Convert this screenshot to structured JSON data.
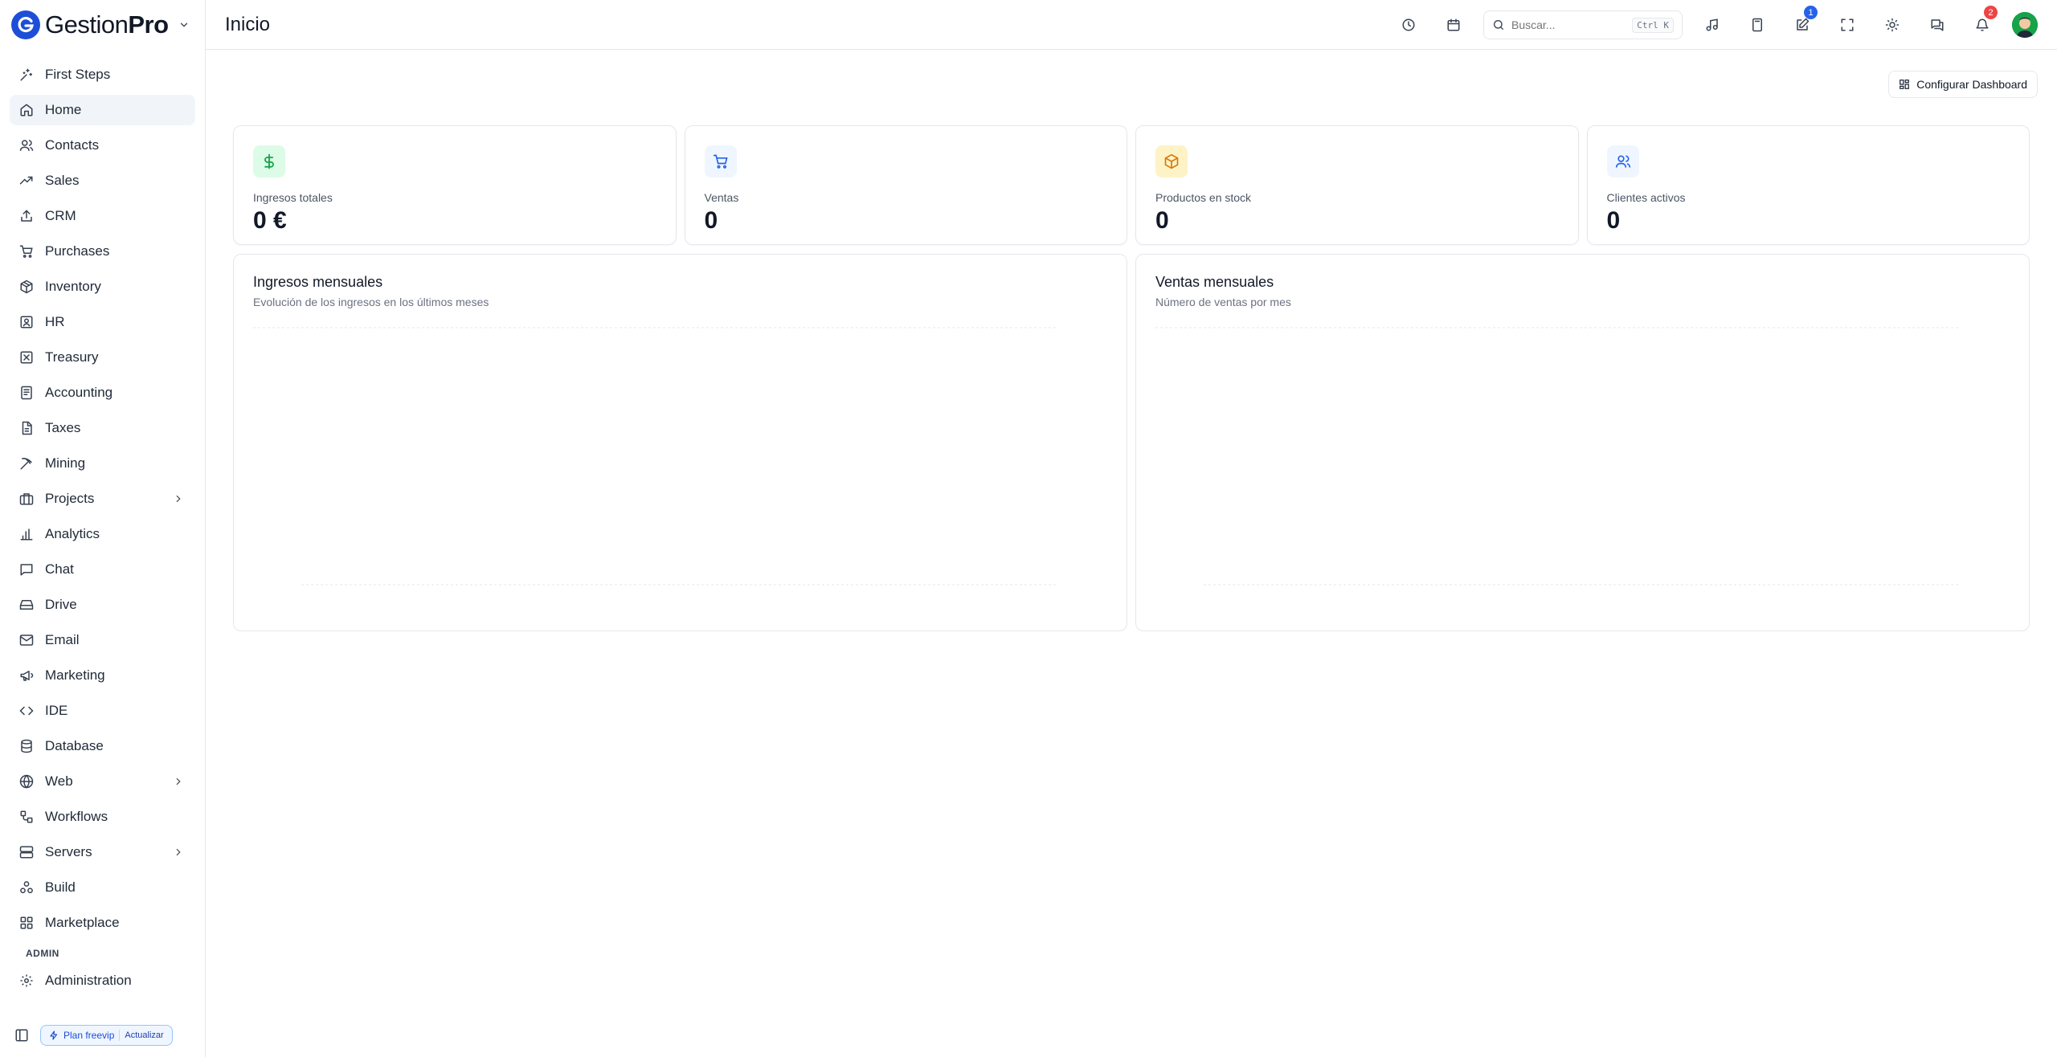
{
  "app": {
    "brand_prefix": "Gestion",
    "brand_suffix": "Pro"
  },
  "sidebar": {
    "items": [
      {
        "label": "First Steps",
        "icon": "sparkles-icon"
      },
      {
        "label": "Home",
        "icon": "home-icon",
        "active": true
      },
      {
        "label": "Contacts",
        "icon": "users-icon"
      },
      {
        "label": "Sales",
        "icon": "trending-up-icon"
      },
      {
        "label": "CRM",
        "icon": "upload-icon"
      },
      {
        "label": "Purchases",
        "icon": "cart-icon"
      },
      {
        "label": "Inventory",
        "icon": "package-icon"
      },
      {
        "label": "HR",
        "icon": "id-badge-icon"
      },
      {
        "label": "Treasury",
        "icon": "box-x-icon"
      },
      {
        "label": "Accounting",
        "icon": "ledger-icon"
      },
      {
        "label": "Taxes",
        "icon": "document-icon"
      },
      {
        "label": "Mining",
        "icon": "pickaxe-icon"
      },
      {
        "label": "Projects",
        "icon": "briefcase-icon",
        "chevron": true
      },
      {
        "label": "Analytics",
        "icon": "bar-chart-icon"
      },
      {
        "label": "Chat",
        "icon": "message-square-icon"
      },
      {
        "label": "Drive",
        "icon": "hard-drive-icon"
      },
      {
        "label": "Email",
        "icon": "mail-icon"
      },
      {
        "label": "Marketing",
        "icon": "megaphone-icon"
      },
      {
        "label": "IDE",
        "icon": "code-icon"
      },
      {
        "label": "Database",
        "icon": "database-icon"
      },
      {
        "label": "Web",
        "icon": "globe-icon",
        "chevron": true
      },
      {
        "label": "Workflows",
        "icon": "workflow-icon"
      },
      {
        "label": "Servers",
        "icon": "server-icon",
        "chevron": true
      },
      {
        "label": "Build",
        "icon": "build-icon"
      },
      {
        "label": "Marketplace",
        "icon": "grid-icon"
      }
    ],
    "admin_section": "ADMIN",
    "admin_items": [
      {
        "label": "Administration",
        "icon": "gear-icon"
      }
    ],
    "plan_label": "Plan freevip",
    "plan_upgrade": "Actualizar"
  },
  "header": {
    "title": "Inicio",
    "search_placeholder": "Buscar...",
    "search_shortcut": "Ctrl K",
    "notes_badge": "1",
    "notifications_badge": "2"
  },
  "dashboard": {
    "config_button": "Configurar Dashboard",
    "kpis": [
      {
        "label": "Ingresos totales",
        "value": "0 €",
        "icon": "dollar-icon",
        "color": "#16a34a",
        "bg": "#dcfce7"
      },
      {
        "label": "Ventas",
        "value": "0",
        "icon": "cart-icon",
        "color": "#2563eb",
        "bg": "#eff6ff"
      },
      {
        "label": "Productos en stock",
        "value": "0",
        "icon": "package-icon",
        "color": "#d97706",
        "bg": "#fef3c7"
      },
      {
        "label": "Clientes activos",
        "value": "0",
        "icon": "users-icon",
        "color": "#2563eb",
        "bg": "#eff6ff"
      }
    ],
    "charts": [
      {
        "title": "Ingresos mensuales",
        "subtitle": "Evolución de los ingresos en los últimos meses"
      },
      {
        "title": "Ventas mensuales",
        "subtitle": "Número de ventas por mes"
      }
    ]
  },
  "colors": {
    "accent": "#2563eb",
    "danger": "#ef4444",
    "border": "#e5e7eb",
    "active_bg": "#f1f5f9"
  }
}
